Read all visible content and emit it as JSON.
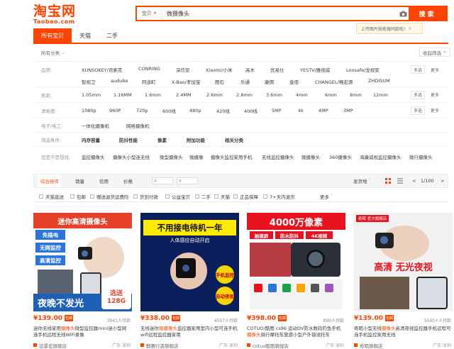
{
  "logo": {
    "cn": "淘宝网",
    "url": "Taobao.com"
  },
  "search": {
    "scope": "宝贝",
    "query": "微摄像头",
    "button": "搜索",
    "tip": "上传图片就能搜同款啦!",
    "tip_close": "×"
  },
  "tabs": [
    "所有宝贝",
    "天猫",
    "二手"
  ],
  "crumb": {
    "label": "所有分类",
    "arrow": "›"
  },
  "fold": "收起筛选 ^",
  "filters": {
    "brand": {
      "label": "品牌:",
      "row1": [
        "XUNSOKEY/讯索克",
        "CONRING",
        "深信安",
        "Xiaomi/小米",
        "高木",
        "优易仕",
        "YESTV/雅视威",
        "Loosafe/龙视安"
      ],
      "row2": [
        "智视卫",
        "audube",
        "阿迪町",
        "X-Bao/孝加宝",
        "图石",
        "乐通",
        "康佣",
        "金佰",
        "CHANGEL/畅宏源",
        "ZHDISUM"
      ],
      "multi": "多选",
      "more": "更多"
    },
    "focal": {
      "label": "焦距:",
      "values": [
        "1.05mm",
        "1.16MM",
        "1.6mm",
        "2.4MM",
        "2.6mm",
        "2.8mm",
        "3.6mm",
        "4mm",
        "6mm",
        "8mm",
        "12mm"
      ],
      "multi": "多选",
      "more": "更多"
    },
    "resolution": {
      "label": "清晰度:",
      "values": [
        "1080p",
        "960P",
        "720p",
        "600线",
        "480p",
        "420线",
        "400线",
        "5MP",
        "4k",
        "4MP",
        "3MP"
      ],
      "multi": "多选",
      "more": "更多"
    },
    "electronics": {
      "label": "电子/电工:",
      "values": [
        "一体化摄像机",
        "网络摄像机"
      ]
    },
    "criteria": {
      "label": "筛选条件:",
      "values": [
        "内存容量",
        "防抖性能",
        "像素",
        "附加功能",
        "相关分类"
      ],
      "caret": "˅"
    },
    "related": {
      "label": "您是不是想找:",
      "values": [
        "监控摄像头",
        "摄像头小型连无线",
        "微型摄像头",
        "微摄像",
        "摄像头监控家用手机",
        "无线监控摄像头",
        "微摄像头",
        "360摄像头",
        "海康威视监控摄像头",
        "微行摄像头"
      ]
    }
  },
  "sort": {
    "items": [
      "综合排序",
      "销量",
      "信用",
      "价格"
    ],
    "caret": "˅",
    "price_from": "¥",
    "price_to": "¥",
    "ship_to": "发货地",
    "pager": "1/100",
    "prev": "<",
    "next": ">"
  },
  "checks": [
    "天猫直送",
    "包邮",
    "赠送退货运费险",
    "货到付款",
    "公益宝贝",
    "二手",
    "天猫",
    "正品保障",
    "7+天内退货"
  ],
  "checks_more": "更多",
  "products": [
    {
      "ad": "迷你高清摄像头",
      "badges": [
        "免插电",
        "无网监控",
        "高清监控"
      ],
      "bottom": "夜晚不发光",
      "corner": "选送\n128G",
      "price": "¥139.00",
      "by": "包邮",
      "sales": "3041人付款",
      "title_a": "迷你无线家用",
      "title_hl": "摄像头",
      "title_b": "微型监控器mini迷小型网连手机远程无线WiFi录像",
      "shop": "远景宏旗舰店",
      "loc": "广东 深圳"
    },
    {
      "ad": "不用接电待机一年",
      "sub": "人体感应自动开启",
      "labels": [
        "手机监控",
        "自动夜视"
      ],
      "price": "¥338.00",
      "by": "包邮",
      "sales": "4557人付款",
      "title_a": "无线迷你",
      "title_hl": "微摄像头",
      "title_b": "监控器家用室内小型可连手机wifi远程监控器家用",
      "shop": "麒赛行游旗舰店",
      "loc": "广东 深圳"
    },
    {
      "ad": "4000万像素",
      "tags": [
        "触摸屏",
        "防水防抖",
        "4K视频"
      ],
      "price": "¥398.00",
      "by": "包邮",
      "sales": "899人付款",
      "title_a": "COTUO/酷图 cs96 运动DV防水数码钓鱼手机",
      "title_hl": "摄像头",
      "title_b": "骑行摩托车旅游小型户外错误托车",
      "shop": "cotuo酷图旗舰店",
      "loc": "广东 深圳"
    },
    {
      "brand": "奇陌 官方旗舰店",
      "ad": "高清 无光夜视",
      "price": "¥139.00",
      "by": "包邮",
      "sales": "5500+人付款",
      "title_a": "奇陌小型无线",
      "title_hl": "摄像头",
      "title_b": "高清夜视监控器手机远程可连手机监控家用无线",
      "shop": "奇陌旗舰店",
      "loc": "广东 深圳"
    }
  ],
  "colors": {
    "accent": "#ff4400",
    "tab_active": "#ff4400",
    "price": "#ff4400"
  }
}
